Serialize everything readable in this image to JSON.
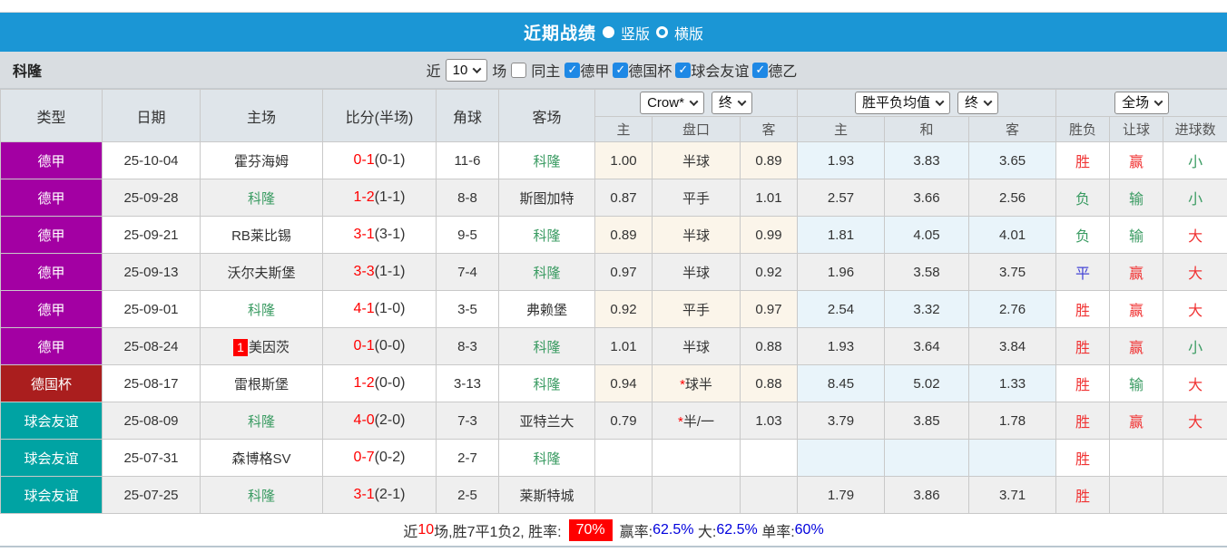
{
  "title_bar": {
    "title": "近期战绩",
    "options": [
      {
        "label": "竖版",
        "selected": true
      },
      {
        "label": "横版",
        "selected": false
      }
    ]
  },
  "filter": {
    "team": "科隆",
    "near_label": "近",
    "recent_count": "10",
    "games_label": "场",
    "same_home": {
      "label": "同主",
      "checked": false
    },
    "leagues": [
      {
        "label": "德甲",
        "checked": true
      },
      {
        "label": "德国杯",
        "checked": true
      },
      {
        "label": "球会友谊",
        "checked": true
      },
      {
        "label": "德乙",
        "checked": true
      }
    ]
  },
  "table": {
    "left_headers": [
      "类型",
      "日期",
      "主场",
      "比分(半场)",
      "角球",
      "客场"
    ],
    "group_selects": {
      "odds_company": "Crow*",
      "odds_time": "终",
      "avg_name": "胜平负均值",
      "avg_time": "终",
      "scope": "全场"
    },
    "sub_headers": [
      "主",
      "盘口",
      "客",
      "主",
      "和",
      "客",
      "胜负",
      "让球",
      "进球数"
    ],
    "highlight_team": "科隆",
    "rows": [
      {
        "type": "德甲",
        "date": "25-10-04",
        "home": "霍芬海姆",
        "home_badge": "",
        "score": "0-1",
        "half": "(0-1)",
        "corner": "11-6",
        "away": "科隆",
        "odds": [
          "1.00",
          "半球",
          "0.89"
        ],
        "handicap_star": false,
        "avg": [
          "1.93",
          "3.83",
          "3.65"
        ],
        "result": "胜",
        "handicap_result": "赢",
        "goals": "小"
      },
      {
        "type": "德甲",
        "date": "25-09-28",
        "home": "科隆",
        "home_badge": "",
        "score": "1-2",
        "half": "(1-1)",
        "corner": "8-8",
        "away": "斯图加特",
        "odds": [
          "0.87",
          "平手",
          "1.01"
        ],
        "handicap_star": false,
        "avg": [
          "2.57",
          "3.66",
          "2.56"
        ],
        "result": "负",
        "handicap_result": "输",
        "goals": "小"
      },
      {
        "type": "德甲",
        "date": "25-09-21",
        "home": "RB莱比锡",
        "home_badge": "",
        "score": "3-1",
        "half": "(3-1)",
        "corner": "9-5",
        "away": "科隆",
        "odds": [
          "0.89",
          "半球",
          "0.99"
        ],
        "handicap_star": false,
        "avg": [
          "1.81",
          "4.05",
          "4.01"
        ],
        "result": "负",
        "handicap_result": "输",
        "goals": "大"
      },
      {
        "type": "德甲",
        "date": "25-09-13",
        "home": "沃尔夫斯堡",
        "home_badge": "",
        "score": "3-3",
        "half": "(1-1)",
        "corner": "7-4",
        "away": "科隆",
        "odds": [
          "0.97",
          "半球",
          "0.92"
        ],
        "handicap_star": false,
        "avg": [
          "1.96",
          "3.58",
          "3.75"
        ],
        "result": "平",
        "handicap_result": "赢",
        "goals": "大"
      },
      {
        "type": "德甲",
        "date": "25-09-01",
        "home": "科隆",
        "home_badge": "",
        "score": "4-1",
        "half": "(1-0)",
        "corner": "3-5",
        "away": "弗赖堡",
        "odds": [
          "0.92",
          "平手",
          "0.97"
        ],
        "handicap_star": false,
        "avg": [
          "2.54",
          "3.32",
          "2.76"
        ],
        "result": "胜",
        "handicap_result": "赢",
        "goals": "大"
      },
      {
        "type": "德甲",
        "date": "25-08-24",
        "home": "美因茨",
        "home_badge": "1",
        "score": "0-1",
        "half": "(0-0)",
        "corner": "8-3",
        "away": "科隆",
        "odds": [
          "1.01",
          "半球",
          "0.88"
        ],
        "handicap_star": false,
        "avg": [
          "1.93",
          "3.64",
          "3.84"
        ],
        "result": "胜",
        "handicap_result": "赢",
        "goals": "小"
      },
      {
        "type": "德国杯",
        "date": "25-08-17",
        "home": "雷根斯堡",
        "home_badge": "",
        "score": "1-2",
        "half": "(0-0)",
        "corner": "3-13",
        "away": "科隆",
        "odds": [
          "0.94",
          "球半",
          "0.88"
        ],
        "handicap_star": true,
        "avg": [
          "8.45",
          "5.02",
          "1.33"
        ],
        "result": "胜",
        "handicap_result": "输",
        "goals": "大"
      },
      {
        "type": "球会友谊",
        "date": "25-08-09",
        "home": "科隆",
        "home_badge": "",
        "score": "4-0",
        "half": "(2-0)",
        "corner": "7-3",
        "away": "亚特兰大",
        "odds": [
          "0.79",
          "半/一",
          "1.03"
        ],
        "handicap_star": true,
        "avg": [
          "3.79",
          "3.85",
          "1.78"
        ],
        "result": "胜",
        "handicap_result": "赢",
        "goals": "大"
      },
      {
        "type": "球会友谊",
        "date": "25-07-31",
        "home": "森博格SV",
        "home_badge": "",
        "score": "0-7",
        "half": "(0-2)",
        "corner": "2-7",
        "away": "科隆",
        "odds": [
          "",
          "",
          ""
        ],
        "handicap_star": false,
        "avg": [
          "",
          "",
          ""
        ],
        "result": "胜",
        "handicap_result": "",
        "goals": ""
      },
      {
        "type": "球会友谊",
        "date": "25-07-25",
        "home": "科隆",
        "home_badge": "",
        "score": "3-1",
        "half": "(2-1)",
        "corner": "2-5",
        "away": "莱斯特城",
        "odds": [
          "",
          "",
          ""
        ],
        "handicap_star": false,
        "avg": [
          "1.79",
          "3.86",
          "3.71"
        ],
        "result": "胜",
        "handicap_result": "",
        "goals": ""
      }
    ]
  },
  "footer": {
    "segments": [
      {
        "text": "近",
        "style": "plain"
      },
      {
        "text": "10",
        "style": "red"
      },
      {
        "text": "场,胜7平1负2, 胜率:",
        "style": "plain"
      },
      {
        "text": "70%",
        "style": "badge"
      },
      {
        "text": "赢率:",
        "style": "plain"
      },
      {
        "text": "62.5%",
        "style": "blue"
      },
      {
        "text": " 大:",
        "style": "plain"
      },
      {
        "text": "62.5%",
        "style": "blue"
      },
      {
        "text": " 单率:",
        "style": "plain"
      },
      {
        "text": "60%",
        "style": "blue"
      }
    ]
  },
  "colors": {
    "header_blue": "#1b96d5",
    "type_colors": {
      "德甲": "#a300a3",
      "德国杯": "#aa1e1e",
      "球会友谊": "#00a3a3"
    },
    "result_color_map": {
      "胜": "red",
      "平": "blue",
      "负": "green",
      "赢": "red",
      "输": "green",
      "大": "red",
      "小": "green"
    },
    "red": "#f03333",
    "green": "#3a9b62",
    "blue": "#4444d5",
    "score_red": "#ff0000",
    "value_blue": "#0000dd"
  }
}
